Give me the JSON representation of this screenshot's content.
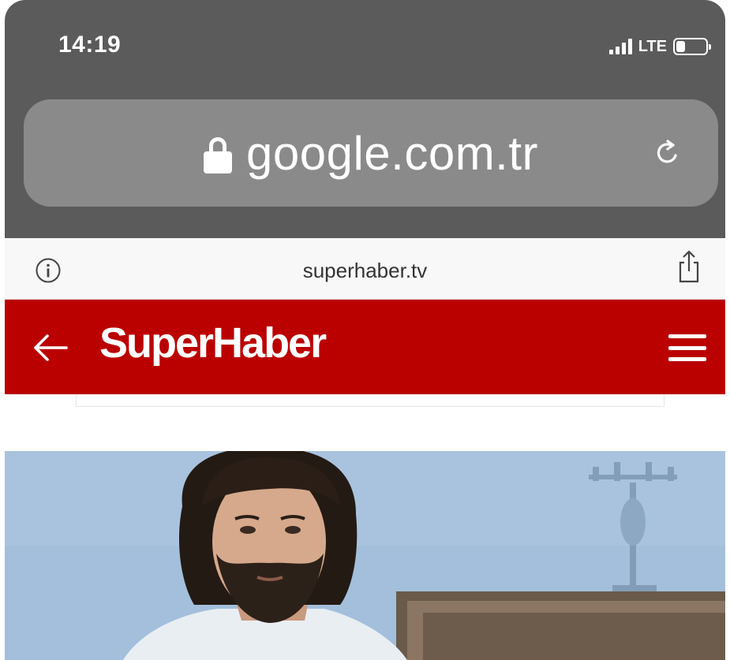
{
  "status_bar": {
    "time": "14:19",
    "network": "LTE",
    "signal_bars": 4,
    "battery_level": 0.3
  },
  "browser": {
    "address": "google.com.tr",
    "site_url": "superhaber.tv"
  },
  "site": {
    "logo": "SuperHaber",
    "brand_color": "#bb0000"
  },
  "icons": {
    "lock": "lock-icon",
    "reload": "reload-icon",
    "info": "info-icon",
    "share": "share-icon",
    "back": "back-arrow-icon",
    "menu": "hamburger-menu-icon"
  }
}
